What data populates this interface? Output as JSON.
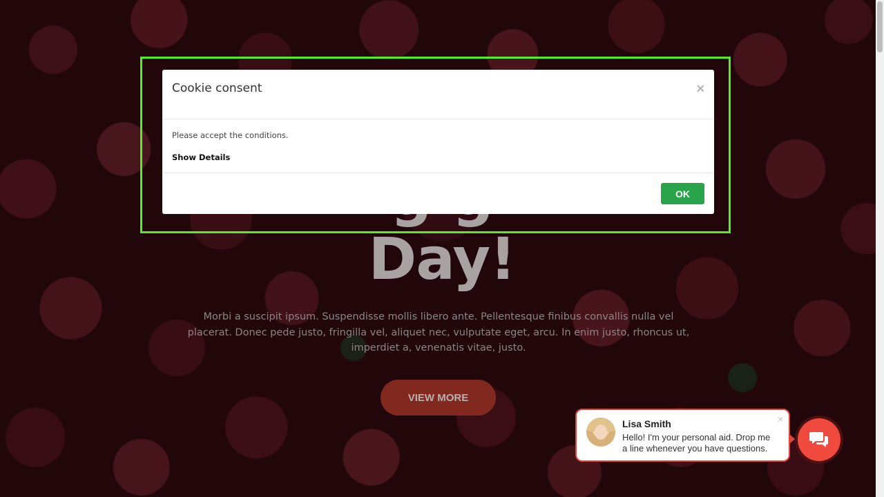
{
  "hero": {
    "title_line2": "Day!",
    "title_line1_partial": "g g",
    "description": "Morbi a suscipit ipsum. Suspendisse mollis libero ante. Pellentesque finibus convallis nulla vel placerat. Donec pede justo, fringilla vel, aliquet nec, vulputate eget, arcu. In enim justo, rhoncus ut, imperdiet a, venenatis vitae, justo.",
    "cta_label": "VIEW MORE"
  },
  "cookie_modal": {
    "title": "Cookie consent",
    "close_glyph": "×",
    "message": "Please accept the conditions.",
    "details_link": "Show Details",
    "ok_label": "OK"
  },
  "chat": {
    "agent_name": "Lisa Smith",
    "message": "Hello! I'm your personal aid. Drop me a line whenever you have questions.",
    "close_glyph": "×",
    "launcher_icon": "chat-bubbles-icon"
  },
  "colors": {
    "highlight": "#55ee22",
    "ok_button": "#2aa44b",
    "chat_accent": "#f04a3e",
    "cta": "#82291f"
  }
}
